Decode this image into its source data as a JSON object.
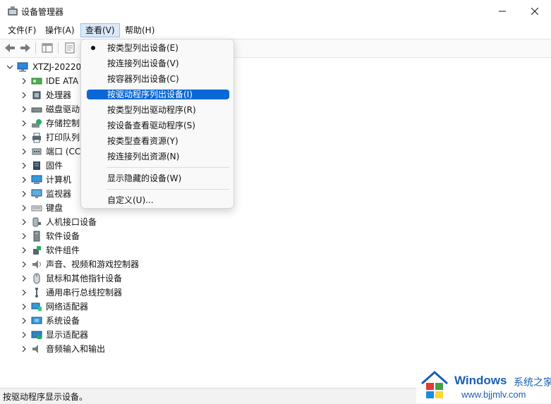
{
  "window": {
    "title": "设备管理器"
  },
  "menubar": {
    "file": "文件(F)",
    "action": "操作(A)",
    "view": "查看(V)",
    "help": "帮助(H)"
  },
  "tree": {
    "root": "XTZJ-20220",
    "items": [
      {
        "label": "IDE ATA",
        "icon": "ide-controller-icon"
      },
      {
        "label": "处理器",
        "icon": "processor-icon"
      },
      {
        "label": "磁盘驱动",
        "icon": "disk-drive-icon"
      },
      {
        "label": "存储控制",
        "icon": "storage-controller-icon"
      },
      {
        "label": "打印队列",
        "icon": "print-queue-icon"
      },
      {
        "label": "端口 (CC",
        "icon": "port-icon"
      },
      {
        "label": "固件",
        "icon": "firmware-icon"
      },
      {
        "label": "计算机",
        "icon": "computer-icon"
      },
      {
        "label": "监视器",
        "icon": "monitor-icon"
      },
      {
        "label": "键盘",
        "icon": "keyboard-icon"
      },
      {
        "label": "人机接口设备",
        "icon": "hid-icon"
      },
      {
        "label": "软件设备",
        "icon": "software-device-icon"
      },
      {
        "label": "软件组件",
        "icon": "software-component-icon"
      },
      {
        "label": "声音、视频和游戏控制器",
        "icon": "speaker-icon"
      },
      {
        "label": "鼠标和其他指针设备",
        "icon": "mouse-icon"
      },
      {
        "label": "通用串行总线控制器",
        "icon": "usb-icon"
      },
      {
        "label": "网络适配器",
        "icon": "network-adapter-icon"
      },
      {
        "label": "系统设备",
        "icon": "system-device-icon"
      },
      {
        "label": "显示适配器",
        "icon": "display-adapter-icon"
      },
      {
        "label": "音频输入和输出",
        "icon": "audio-io-icon"
      }
    ]
  },
  "view_menu": {
    "items": [
      "按类型列出设备(E)",
      "按连接列出设备(V)",
      "按容器列出设备(C)",
      "按驱动程序列出设备(I)",
      "按类型列出驱动程序(R)",
      "按设备查看驱动程序(S)",
      "按类型查看资源(Y)",
      "按连接列出资源(N)",
      "显示隐藏的设备(W)",
      "自定义(U)..."
    ]
  },
  "statusbar": {
    "text": "按驱动程序显示设备。"
  },
  "watermark": {
    "brand": "Windows",
    "brand_cn": "系统之家",
    "url": "www.bjjmlv.com"
  },
  "colors": {
    "highlight": "#0a67d6",
    "menu_active": "#dbe9f8",
    "watermark_blue": "#1a5fb4"
  }
}
